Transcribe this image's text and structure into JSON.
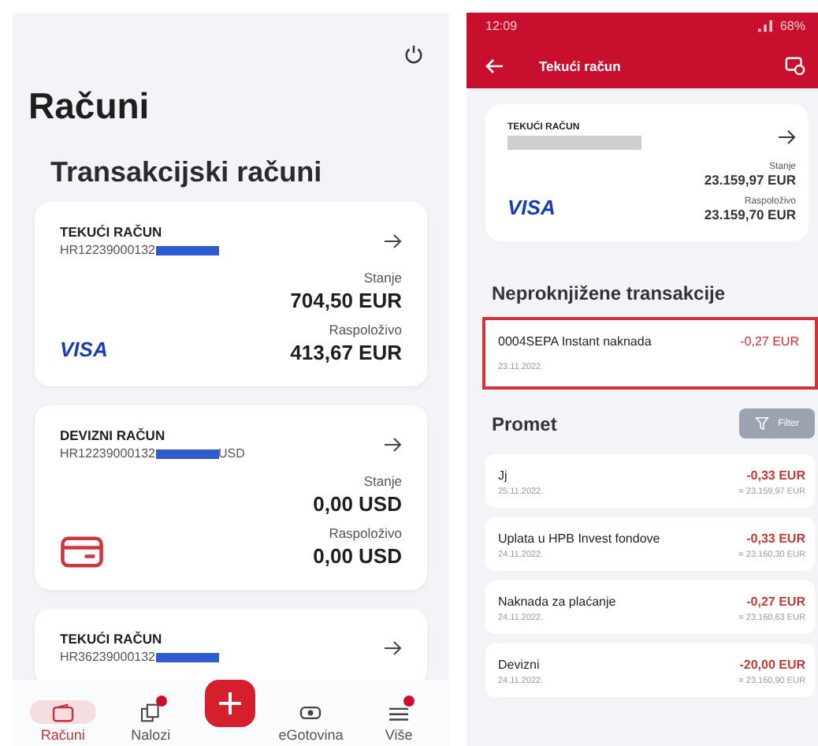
{
  "left": {
    "title": "Računi",
    "section": "Transakcijski računi",
    "accounts": [
      {
        "type": "TEKUĆI RAČUN",
        "iban": "HR12239000132",
        "balance_label": "Stanje",
        "balance": "704,50 EUR",
        "available_label": "Raspoloživo",
        "available": "413,67 EUR",
        "kind": "visa",
        "logo_text": "VISA"
      },
      {
        "type": "DEVIZNI RAČUN",
        "iban": "HR12239000132",
        "iban_suffix": "USD",
        "balance_label": "Stanje",
        "balance": "0,00 USD",
        "available_label": "Raspoloživo",
        "available": "0,00 USD",
        "kind": "card"
      },
      {
        "type": "TEKUĆI RAČUN",
        "iban": "HR36239000132"
      }
    ],
    "nav": [
      {
        "kind": "wallet",
        "label": "Računi",
        "selected": true,
        "badge": false
      },
      {
        "kind": "orders",
        "label": "Nalozi",
        "selected": false,
        "badge": true
      },
      {
        "kind": "add"
      },
      {
        "kind": "cash",
        "label": "eGotovina",
        "selected": false,
        "badge": false
      },
      {
        "kind": "menu",
        "label": "Više",
        "selected": false,
        "badge": true
      }
    ]
  },
  "right": {
    "time": "12:09",
    "battery": "68%",
    "title": "Tekući račun",
    "card": {
      "type": "TEKUĆI RAČUN",
      "balance_label": "Stanje",
      "balance": "23.159,97 EUR",
      "available_label": "Raspoloživo",
      "available": "23.159,70 EUR",
      "logo_text": "VISA"
    },
    "pending_title": "Neproknjižene transakcije",
    "pending": [
      {
        "desc": "0004SEPA Instant naknada",
        "date": "23.11.2022.",
        "amount": "-0,27 EUR",
        "highlighted": true
      }
    ],
    "promet_title": "Promet",
    "filter": "Filter",
    "transactions": [
      {
        "desc": "Jj",
        "date": "25.11.2022.",
        "amount": "-0,33 EUR",
        "balance": "= 23.159,97 EUR"
      },
      {
        "desc": "Uplata u HPB Invest fondove",
        "date": "24.11.2022.",
        "amount": "-0,33 EUR",
        "balance": "= 23.160,30 EUR"
      },
      {
        "desc": "Naknada za plaćanje",
        "date": "24.11.2022.",
        "amount": "-0,27 EUR",
        "balance": "= 23.160,63 EUR"
      },
      {
        "desc": "Devizni",
        "date": "24.11.2022.",
        "amount": "-20,00 EUR",
        "balance": "= 23.160,90 EUR"
      }
    ]
  }
}
